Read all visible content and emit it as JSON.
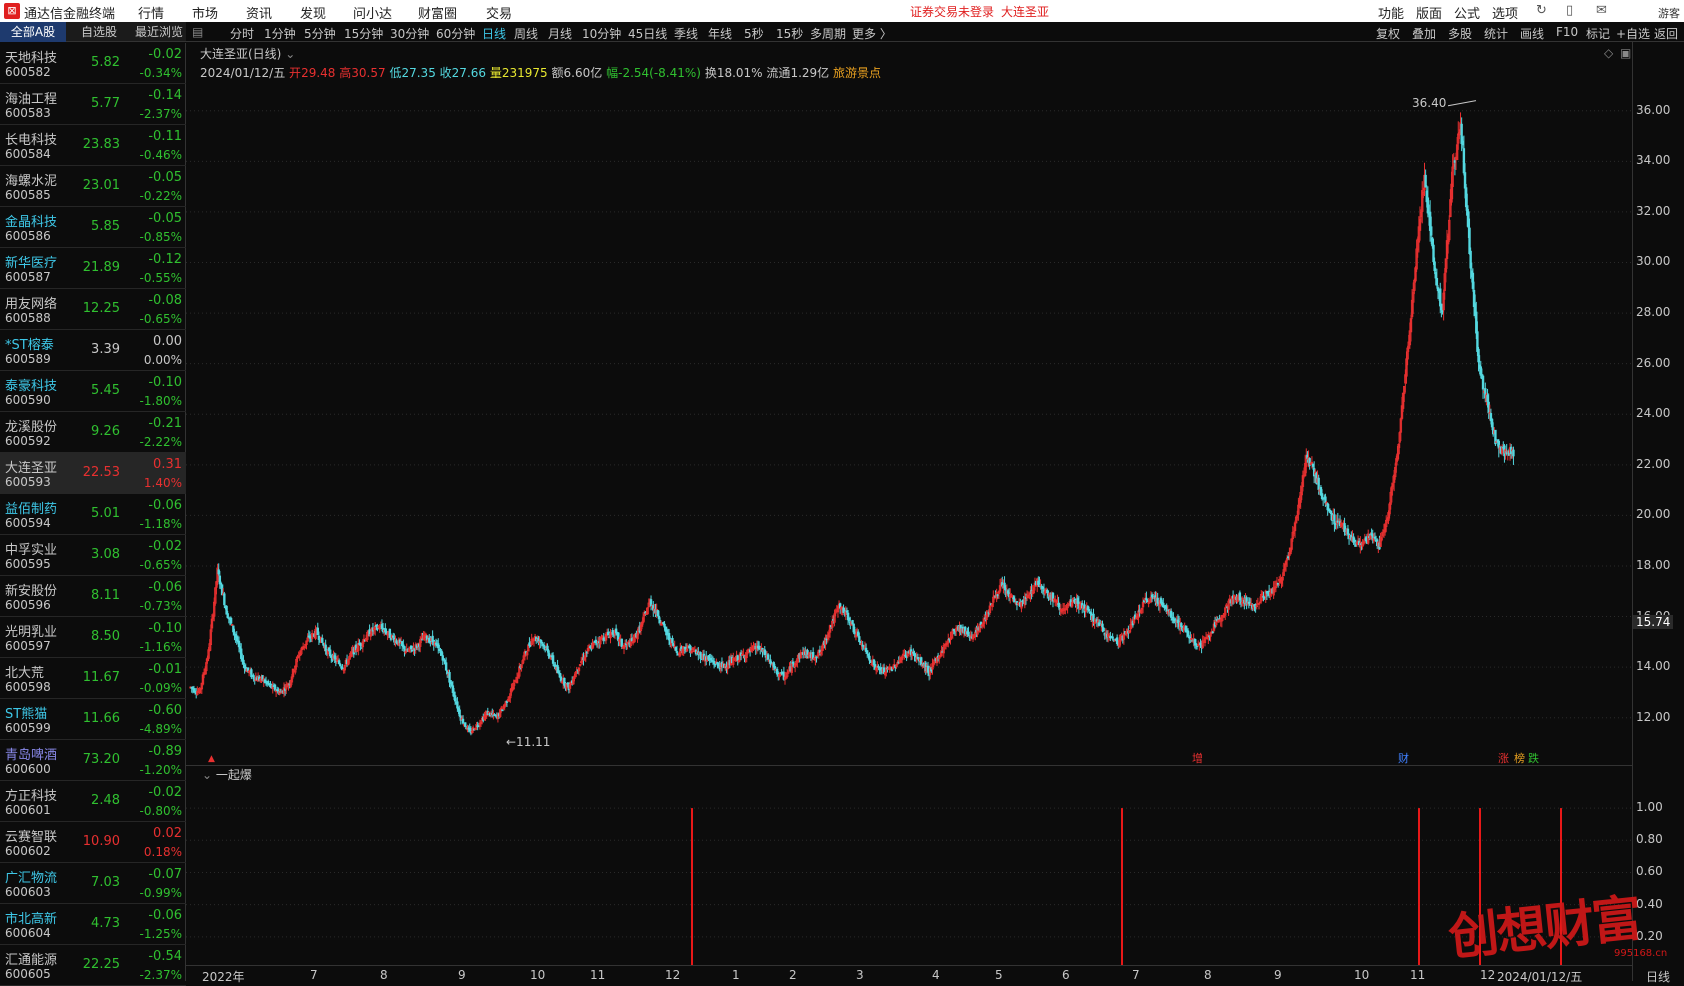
{
  "app_title": "通达信金融终端",
  "menu": [
    "行情",
    "市场",
    "资讯",
    "发现",
    "问小达",
    "财富圈",
    "交易"
  ],
  "notice": "证券交易未登录",
  "notice_stock": "大连圣亚",
  "right_menu": [
    "功能",
    "版面",
    "公式",
    "选项"
  ],
  "guest": "游客",
  "list_tabs": [
    "全部A股",
    "自选股",
    "最近浏览"
  ],
  "stocks": [
    {
      "name": "天地科技",
      "code": "600582",
      "price": "5.82",
      "change": "-0.02",
      "pct": "-0.34%",
      "dir": "down",
      "nameColor": "#c8c8c8"
    },
    {
      "name": "海油工程",
      "code": "600583",
      "price": "5.77",
      "change": "-0.14",
      "pct": "-2.37%",
      "dir": "down",
      "nameColor": "#c8c8c8"
    },
    {
      "name": "长电科技",
      "code": "600584",
      "price": "23.83",
      "change": "-0.11",
      "pct": "-0.46%",
      "dir": "down",
      "nameColor": "#c8c8c8"
    },
    {
      "name": "海螺水泥",
      "code": "600585",
      "price": "23.01",
      "change": "-0.05",
      "pct": "-0.22%",
      "dir": "down",
      "nameColor": "#c8c8c8"
    },
    {
      "name": "金晶科技",
      "code": "600586",
      "price": "5.85",
      "change": "-0.05",
      "pct": "-0.85%",
      "dir": "down",
      "nameColor": "#3ec8e8"
    },
    {
      "name": "新华医疗",
      "code": "600587",
      "price": "21.89",
      "change": "-0.12",
      "pct": "-0.55%",
      "dir": "down",
      "nameColor": "#3ec8e8"
    },
    {
      "name": "用友网络",
      "code": "600588",
      "price": "12.25",
      "change": "-0.08",
      "pct": "-0.65%",
      "dir": "down",
      "nameColor": "#c8c8c8"
    },
    {
      "name": "*ST榕泰",
      "code": "600589",
      "price": "3.39",
      "change": "0.00",
      "pct": "0.00%",
      "dir": "flat",
      "nameColor": "#3ec8e8"
    },
    {
      "name": "泰豪科技",
      "code": "600590",
      "price": "5.45",
      "change": "-0.10",
      "pct": "-1.80%",
      "dir": "down",
      "nameColor": "#3ec8e8"
    },
    {
      "name": "龙溪股份",
      "code": "600592",
      "price": "9.26",
      "change": "-0.21",
      "pct": "-2.22%",
      "dir": "down",
      "nameColor": "#c8c8c8"
    },
    {
      "name": "大连圣亚",
      "code": "600593",
      "price": "22.53",
      "change": "0.31",
      "pct": "1.40%",
      "dir": "up",
      "nameColor": "#c8c8c8",
      "selected": true
    },
    {
      "name": "益佰制药",
      "code": "600594",
      "price": "5.01",
      "change": "-0.06",
      "pct": "-1.18%",
      "dir": "down",
      "nameColor": "#3ec8e8"
    },
    {
      "name": "中孚实业",
      "code": "600595",
      "price": "3.08",
      "change": "-0.02",
      "pct": "-0.65%",
      "dir": "down",
      "nameColor": "#c8c8c8"
    },
    {
      "name": "新安股份",
      "code": "600596",
      "price": "8.11",
      "change": "-0.06",
      "pct": "-0.73%",
      "dir": "down",
      "nameColor": "#c8c8c8"
    },
    {
      "name": "光明乳业",
      "code": "600597",
      "price": "8.50",
      "change": "-0.10",
      "pct": "-1.16%",
      "dir": "down",
      "nameColor": "#c8c8c8"
    },
    {
      "name": "北大荒",
      "code": "600598",
      "price": "11.67",
      "change": "-0.01",
      "pct": "-0.09%",
      "dir": "down",
      "nameColor": "#c8c8c8"
    },
    {
      "name": "ST熊猫",
      "code": "600599",
      "price": "11.66",
      "change": "-0.60",
      "pct": "-4.89%",
      "dir": "down",
      "nameColor": "#3ec8e8"
    },
    {
      "name": "青岛啤酒",
      "code": "600600",
      "price": "73.20",
      "change": "-0.89",
      "pct": "-1.20%",
      "dir": "down",
      "nameColor": "#8888e8"
    },
    {
      "name": "方正科技",
      "code": "600601",
      "price": "2.48",
      "change": "-0.02",
      "pct": "-0.80%",
      "dir": "down",
      "nameColor": "#c8c8c8"
    },
    {
      "name": "云赛智联",
      "code": "600602",
      "price": "10.90",
      "change": "0.02",
      "pct": "0.18%",
      "dir": "up",
      "nameColor": "#c8c8c8"
    },
    {
      "name": "广汇物流",
      "code": "600603",
      "price": "7.03",
      "change": "-0.07",
      "pct": "-0.99%",
      "dir": "down",
      "nameColor": "#3ec8e8"
    },
    {
      "name": "市北高新",
      "code": "600604",
      "price": "4.73",
      "change": "-0.06",
      "pct": "-1.25%",
      "dir": "down",
      "nameColor": "#3ec8e8"
    },
    {
      "name": "汇通能源",
      "code": "600605",
      "price": "22.25",
      "change": "-0.54",
      "pct": "-2.37%",
      "dir": "down",
      "nameColor": "#c8c8c8"
    }
  ],
  "periods": [
    "分时",
    "1分钟",
    "5分钟",
    "15分钟",
    "30分钟",
    "60分钟",
    "日线",
    "周线",
    "月线",
    "10分钟",
    "45日线",
    "季线",
    "年线",
    "5秒",
    "15秒",
    "多周期",
    "更多 〉"
  ],
  "active_period": "日线",
  "right_tools": [
    "复权",
    "叠加",
    "多股",
    "统计",
    "画线",
    "F10",
    "标记",
    "+自选",
    "返回"
  ],
  "info": {
    "title": "大连圣亚(日线)",
    "date": "2024/01/12/五",
    "open_label": "开",
    "open": "29.48",
    "high_label": "高",
    "high": "30.57",
    "low_label": "低",
    "low": "27.35",
    "close_label": "收",
    "close": "27.66",
    "vol_label": "量",
    "vol": "231975",
    "amt_label": "额",
    "amt": "6.60亿",
    "amp_label": "幅",
    "amp": "-2.54(-8.41%)",
    "turn_label": "换",
    "turn": "18.01%",
    "float_label": "流通",
    "float": "1.29亿",
    "sector": "旅游景点"
  },
  "chart_data": [
    {
      "type": "candlestick",
      "title": "大连圣亚(日线)",
      "ylim": [
        11,
        36.9
      ],
      "yticks": [
        "36.00",
        "34.00",
        "32.00",
        "30.00",
        "28.00",
        "26.00",
        "24.00",
        "22.00",
        "20.00",
        "18.00",
        "16.00",
        "14.00",
        "12.00"
      ],
      "ytick_values": [
        36,
        34,
        32,
        30,
        28,
        26,
        24,
        22,
        20,
        18,
        16,
        14,
        12
      ],
      "current_price_label": "15.74",
      "current_price": 15.74,
      "max_label": "36.40",
      "min_label": "11.11",
      "xticks": [
        "2022年",
        "7",
        "8",
        "9",
        "10",
        "11",
        "12",
        "1",
        "2",
        "3",
        "4",
        "5",
        "6",
        "7",
        "8",
        "9",
        "10",
        "11",
        "12",
        "2024/01/12/五"
      ],
      "x_unit_label": "日线",
      "markers": [
        {
          "text": "增",
          "color": "#e83030"
        },
        {
          "text": "财",
          "color": "#4080ff"
        },
        {
          "text": "涨",
          "color": "#e83030"
        },
        {
          "text": "榜",
          "color": "#e8a020"
        },
        {
          "text": "跌",
          "color": "#30c030"
        }
      ],
      "up_color": "#e83030",
      "down_color": "#54d8e0",
      "approx_prices": [
        13.2,
        13.0,
        14.6,
        17.8,
        16.2,
        15.2,
        14.0,
        13.6,
        13.5,
        13.2,
        13.0,
        13.4,
        14.5,
        15.1,
        15.4,
        14.7,
        14.3,
        14.0,
        14.6,
        15.0,
        15.4,
        15.6,
        15.3,
        15.0,
        14.6,
        14.8,
        15.2,
        15.0,
        14.4,
        13.2,
        12.0,
        11.4,
        11.8,
        12.2,
        12.0,
        12.6,
        13.4,
        14.4,
        15.2,
        15.0,
        14.4,
        13.6,
        13.2,
        14.0,
        14.6,
        15.0,
        15.2,
        15.4,
        14.8,
        15.0,
        15.6,
        16.6,
        16.0,
        15.2,
        14.6,
        14.8,
        14.6,
        14.4,
        14.2,
        14.0,
        14.2,
        14.4,
        14.6,
        14.8,
        14.4,
        13.8,
        13.6,
        14.2,
        14.6,
        14.4,
        14.6,
        15.6,
        16.4,
        16.0,
        15.2,
        14.6,
        14.0,
        13.8,
        14.0,
        14.4,
        14.6,
        14.2,
        13.8,
        14.4,
        15.0,
        15.6,
        15.4,
        15.2,
        15.8,
        16.6,
        17.2,
        16.8,
        16.4,
        16.8,
        17.4,
        17.0,
        16.6,
        16.2,
        16.6,
        16.4,
        16.0,
        15.6,
        15.2,
        15.0,
        15.4,
        16.0,
        16.6,
        16.8,
        16.4,
        16.0,
        15.6,
        15.2,
        14.8,
        15.2,
        15.8,
        16.4,
        16.8,
        16.6,
        16.4,
        16.8,
        17.0,
        17.4,
        18.6,
        20.4,
        22.4,
        21.4,
        20.4,
        19.8,
        19.6,
        19.0,
        18.8,
        19.2,
        18.8,
        20.2,
        22.4,
        26.0,
        30.0,
        33.5,
        30.0,
        28.0,
        33.2,
        35.6,
        30.6,
        26.0,
        24.4,
        22.8,
        22.5
      ],
      "approx_wick_max_index": 141
    },
    {
      "type": "bar",
      "title": "一起爆",
      "ylim": [
        0,
        1.1
      ],
      "yticks": [
        "1.00",
        "0.80",
        "0.60",
        "0.40",
        "0.20"
      ],
      "ytick_values": [
        1.0,
        0.8,
        0.6,
        0.4,
        0.2
      ],
      "bar_color": "#e81818",
      "signal_dates_approx": [
        "2022-12",
        "2023-07",
        "2023-11",
        "2023-12",
        "2024-01"
      ],
      "signal_values": [
        1,
        1,
        1,
        1,
        1
      ]
    }
  ],
  "watermark": "创想财富",
  "watermark_url": "995168.cn"
}
